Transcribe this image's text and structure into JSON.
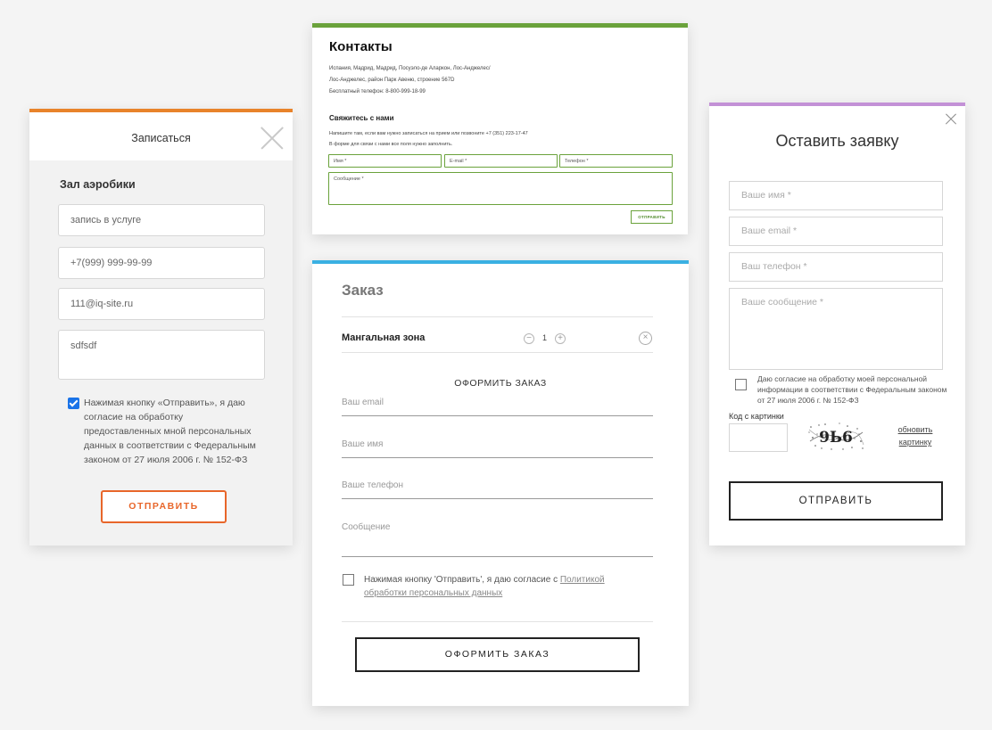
{
  "card1": {
    "title": "Записаться",
    "section": "Зал аэробики",
    "fields": [
      "запись в услуге",
      "+7(999) 999-99-99",
      "111@iq-site.ru",
      "sdfsdf"
    ],
    "agree": "Нажимая кнопку «Отправить», я даю согласие на обработку предоставленных мной персональных данных в соответствии с Федеральным законом от 27 июля 2006 г. № 152-ФЗ",
    "button": "ОТПРАВИТЬ",
    "accent": "#e8832a"
  },
  "card2": {
    "title": "Контакты",
    "addr1": "Испания, Мадрид, Мадрид, Посуэло-де Аларкон, Лос-Анджелес/",
    "addr2": "Лос-Анджелес, район Парк Авеню, строение 567D",
    "phone": "Бесплатный телефон: 8-800-999-18-99",
    "subtitle": "Свяжитесь с нами",
    "text1": "Напишите там, если вам нужно записаться на прием или позвоните +7 (351) 223-17-47",
    "text2": "В форме для связи с нами все поля нужно заполнить.",
    "name": "Имя *",
    "email": "E-mail *",
    "tel": "Телефон *",
    "message": "Сообщение *",
    "button": "ОТПРАВИТЬ",
    "accent": "#6aa23b"
  },
  "card3": {
    "title": "Заказ",
    "item": "Мангальная зона",
    "minus": "−",
    "qty": "1",
    "plus": "+",
    "remove": "×",
    "section": "ОФОРМИТЬ ЗАКАЗ",
    "email": "Ваш email",
    "name": "Ваше имя",
    "tel": "Ваше телефон",
    "message": "Сообщение",
    "agree_text": "Нажимая кнопку 'Отправить', я даю согласие с ",
    "agree_link": "Политикой обработки персональных данных",
    "button": "ОФОРМИТЬ ЗАКАЗ",
    "accent": "#3ab0e2"
  },
  "card4": {
    "title": "Оставить заявку",
    "name": "Ваше имя *",
    "email": "Ваше email *",
    "tel": "Ваш телефон *",
    "message": "Ваше сообщение *",
    "agree": "Даю согласие на обработку моей персональной информации в соответствии с Федеральным законом от 27 июля 2006 г. № 152-ФЗ",
    "captcha_label": "Код с картинки",
    "captcha_text": "9Ь6",
    "refresh": "обновить картинку",
    "button": "ОТПРАВИТЬ",
    "accent": "#c391d6"
  }
}
